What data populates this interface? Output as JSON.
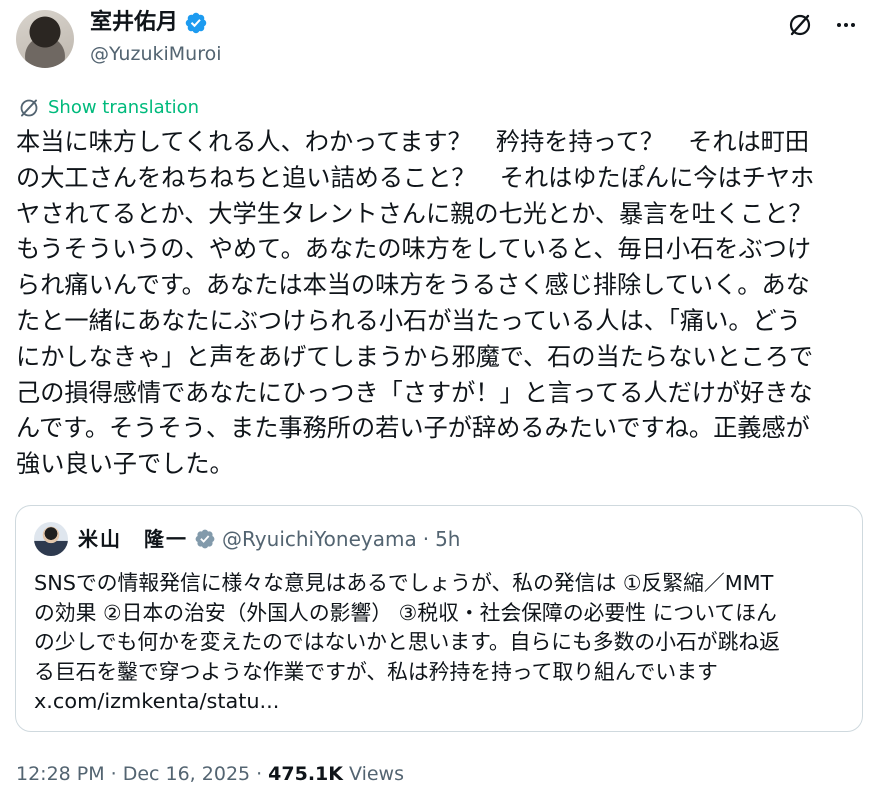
{
  "author": {
    "display_name": "室井佑月",
    "handle": "@YuzukiMuroi",
    "verified": true
  },
  "actions": {
    "grok_icon": "slash-circle-icon",
    "more_icon": "more-dots-icon",
    "more_label": "···"
  },
  "translation": {
    "label": "Show translation",
    "icon": "translate-icon",
    "color": "#00ba7c"
  },
  "tweet_text": "本当に味方してくれる人、わかってます？　矜持を持って？　それは町田\nの大工さんをねちねちと追い詰めること？　それはゆたぽんに今はチヤホ\nヤされてるとか、大学生タレントさんに親の七光とか、暴言を吐くこと？\nもうそういうの、やめて。あなたの味方をしていると、毎日小石をぶつけ\nられ痛いんです。あなたは本当の味方をうるさく感じ排除していく。あな\nたと一緒にあなたにぶつけられる小石が当たっている人は、「痛い。どう\nにかしなきゃ」と声をあげてしまうから邪魔で、石の当たらないところで\n己の損得感情であなたにひっつき「さすが！」と言ってる人だけが好きな\nんです。そうそう、また事務所の若い子が辞めるみたいですね。正義感が\n強い良い子でした。",
  "quote": {
    "display_name": "米山　隆一",
    "handle": "@RyuichiYoneyama",
    "dot": "·",
    "time": "5h",
    "verified": true,
    "text": "SNSでの情報発信に様々な意見はあるでしょうが、私の発信は ①反緊縮／MMT\nの効果 ②日本の治安（外国人の影響） ③税収・社会保障の必要性 についてほん\nの少しでも何かを変えたのではないかと思います。自らにも多数の小石が跳ね返\nる巨石を鑿で穿つような作業ですが、私は矜持を持って取り組んでいます\nx.com/izmkenta/statu..."
  },
  "meta": {
    "time": "12:28 PM",
    "sep1": "·",
    "date": "Dec 16, 2025",
    "sep2": "·",
    "views_count": "475.1K",
    "views_label": "Views"
  },
  "colors": {
    "verified": "#1d9bf0",
    "text": "#0f1419",
    "secondary": "#536471",
    "border": "#cfd9de"
  }
}
